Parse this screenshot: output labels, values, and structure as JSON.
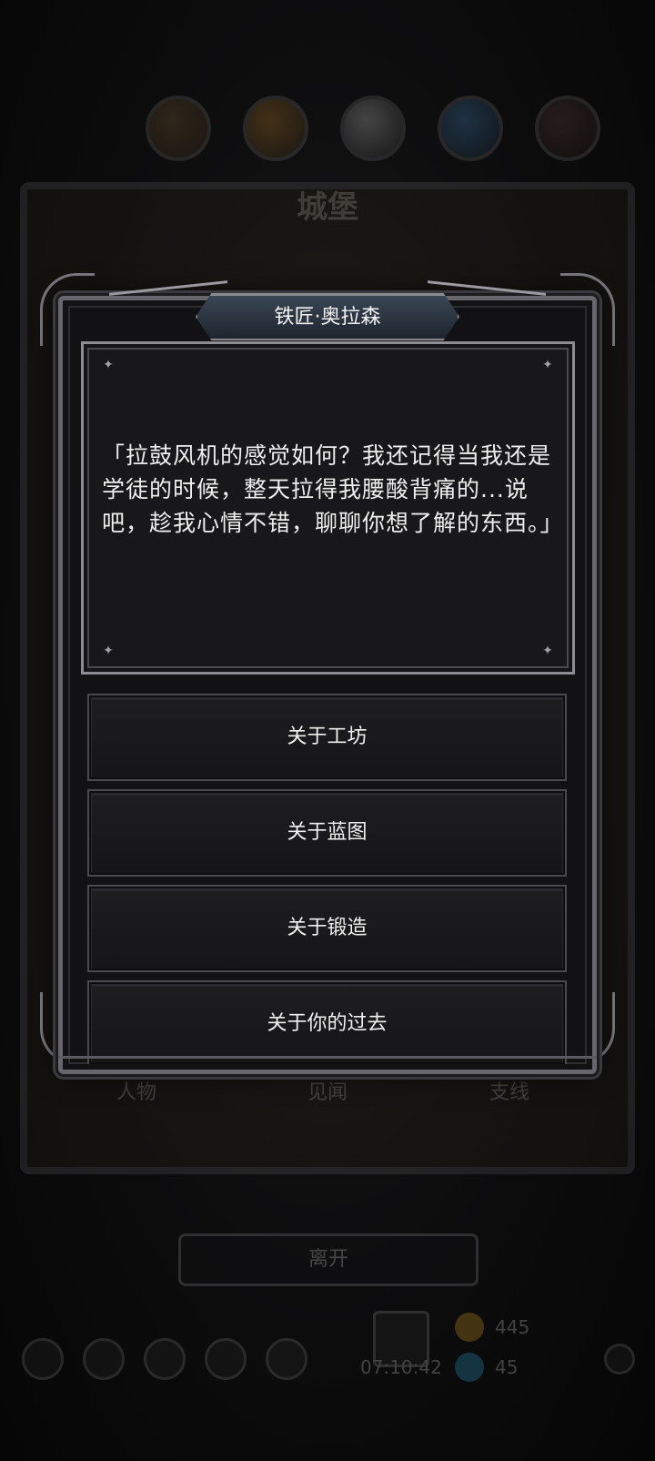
{
  "background": {
    "castle_title": "城堡",
    "castle_tabs": [
      "人物",
      "见闻",
      "支线"
    ],
    "leave_label": "离开",
    "timer": "07:10:42",
    "resources": [
      {
        "name": "gold-coin-icon",
        "value": "445",
        "color": "#d8a020"
      },
      {
        "name": "blue-gem-icon",
        "value": "45",
        "color": "#30a0d0"
      }
    ],
    "top_icons": [
      "stat-icon-1",
      "stat-icon-2",
      "stat-icon-3",
      "stat-icon-4",
      "stat-icon-5"
    ]
  },
  "dialog": {
    "speaker": "铁匠·奥拉森",
    "speech": "「拉鼓风机的感觉如何？我还记得当我还是学徒的时候，整天拉得我腰酸背痛的...说吧，趁我心情不错，聊聊你想了解的东西。」",
    "options": [
      {
        "label": "关于工坊"
      },
      {
        "label": "关于蓝图"
      },
      {
        "label": "关于锻造"
      },
      {
        "label": "关于你的过去"
      }
    ]
  },
  "colors": {
    "panel_bg": "#18181a",
    "frame_silver": "#8c8c92",
    "banner_blue": "#3a4654",
    "text": "#eeeeee"
  }
}
